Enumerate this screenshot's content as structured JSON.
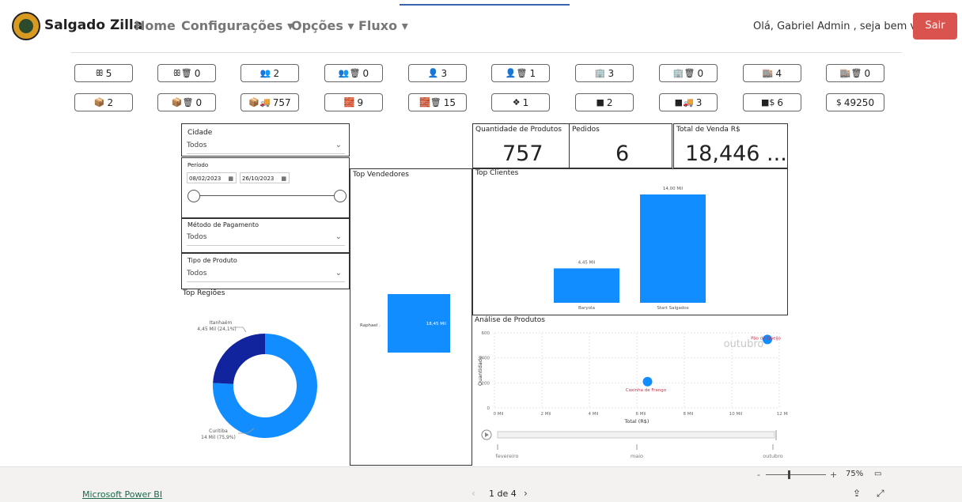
{
  "app": {
    "brand": "Salgado Zilla",
    "nav": [
      "Home",
      "Configurações ▾",
      "Opções ▾",
      "Fluxo ▾"
    ],
    "greeting": "Olá, Gabriel Admin , seja bem vindo!",
    "logout": "Sair"
  },
  "kpis_row1": [
    {
      "icon": "users-icon",
      "glyph": "ꕥ",
      "value": "5"
    },
    {
      "icon": "users-trash-icon",
      "glyph": "ꕥ🗑",
      "value": "0"
    },
    {
      "icon": "group-icon",
      "glyph": "👥",
      "value": "2"
    },
    {
      "icon": "group-trash-icon",
      "glyph": "👥🗑",
      "value": "0"
    },
    {
      "icon": "user-icon",
      "glyph": "👤",
      "value": "3"
    },
    {
      "icon": "user-trash-icon",
      "glyph": "👤🗑",
      "value": "1"
    },
    {
      "icon": "building-icon",
      "glyph": "🏢",
      "value": "3"
    },
    {
      "icon": "building-trash-icon",
      "glyph": "🏢🗑",
      "value": "0"
    },
    {
      "icon": "warehouse-icon",
      "glyph": "🏬",
      "value": "4"
    },
    {
      "icon": "warehouse-trash-icon",
      "glyph": "🏬🗑",
      "value": "0"
    }
  ],
  "kpis_row2": [
    {
      "icon": "box-icon",
      "glyph": "📦",
      "value": "2"
    },
    {
      "icon": "box-trash-icon",
      "glyph": "📦🗑",
      "value": "0"
    },
    {
      "icon": "truck-icon",
      "glyph": "📦🚚",
      "value": "757"
    },
    {
      "icon": "boxes-icon",
      "glyph": "🧱",
      "value": "9"
    },
    {
      "icon": "boxes-trash-icon",
      "glyph": "🧱🗑",
      "value": "15"
    },
    {
      "icon": "dropbox-icon",
      "glyph": "❖",
      "value": "1"
    },
    {
      "icon": "cube-icon",
      "glyph": "■",
      "value": "2"
    },
    {
      "icon": "cube-truck-icon",
      "glyph": "■🚚",
      "value": "3"
    },
    {
      "icon": "cube-dollar-icon",
      "glyph": "■$",
      "value": "6"
    },
    {
      "icon": "dollar-icon",
      "glyph": "$",
      "value": "49250"
    }
  ],
  "filters": {
    "cidade_label": "Cidade",
    "cidade_value": "Todos",
    "periodo_label": "Período",
    "date_start": "08/02/2023",
    "date_end": "26/10/2023",
    "metodo_label": "Método de Pagamento",
    "metodo_value": "Todos",
    "tipo_label": "Tipo de Produto",
    "tipo_value": "Todos"
  },
  "cards": {
    "qtd_label": "Quantidade de Produtos",
    "qtd_value": "757",
    "pedidos_label": "Pedidos",
    "pedidos_value": "6",
    "venda_label": "Total de Venda R$",
    "venda_value": "18,446 ..."
  },
  "chart_data": [
    {
      "type": "pie",
      "title": "Top Regiões",
      "categories": [
        "Curitiba",
        "Itanhaém"
      ],
      "values": [
        14,
        4.45
      ],
      "labels": [
        "14 Mil (75,9%)",
        "4,45 Mil (24,1%)"
      ],
      "colors": [
        "#118dff",
        "#12239e"
      ]
    },
    {
      "type": "bar",
      "title": "Top Vendedores",
      "categories": [
        "Raphael ."
      ],
      "values": [
        18.45
      ],
      "labels": [
        "18,45 Mil"
      ]
    },
    {
      "type": "bar",
      "title": "Top Clientes",
      "categories": [
        "Baryola",
        "Start Salgados"
      ],
      "values": [
        4.45,
        14
      ],
      "labels": [
        "4,45 Mil",
        "14,00 Mil"
      ]
    },
    {
      "type": "scatter",
      "title": "Análise de Produtos",
      "xlabel": "Total (R$)",
      "ylabel": "Quantidade",
      "xticks": [
        "0 Mil",
        "2 Mil",
        "4 Mil",
        "6 Mil",
        "8 Mil",
        "10 Mil",
        "12 Mil"
      ],
      "yticks": [
        "0",
        "200",
        "400",
        "600"
      ],
      "xlim": [
        0,
        12
      ],
      "ylim": [
        0,
        600
      ],
      "points": [
        {
          "name": "Coxinha de Frango",
          "x": 6.45,
          "y": 210
        },
        {
          "name": "Pão de Queijo",
          "x": 11.5,
          "y": 547
        }
      ],
      "play_axis": {
        "current": "outubro",
        "labels": [
          "fevereiro",
          "maio",
          "outubro"
        ]
      }
    }
  ],
  "footer": {
    "brand_link": "Microsoft Power BI",
    "pager": "1 de 4",
    "zoom": "75%"
  }
}
